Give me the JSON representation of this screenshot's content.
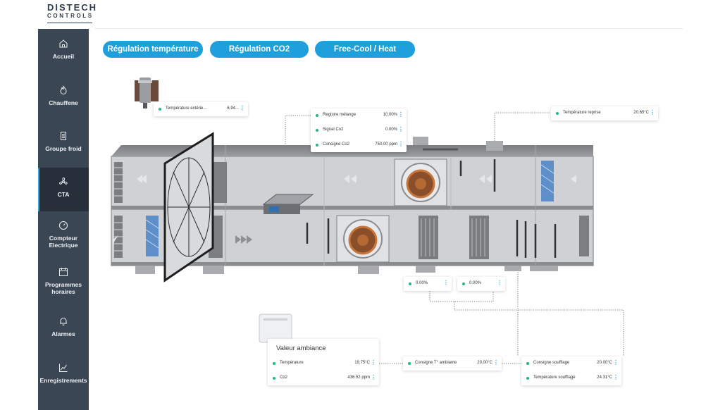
{
  "brand": {
    "line1": "DISTECH",
    "line2": "CONTROLS"
  },
  "sidebar": {
    "items": [
      {
        "label": "Accueil",
        "icon": "home-icon"
      },
      {
        "label": "Chauffene",
        "icon": "flame-icon"
      },
      {
        "label": "Groupe froid",
        "icon": "chiller-icon"
      },
      {
        "label": "CTA",
        "icon": "fan-icon"
      },
      {
        "label": "Compteur Electrique",
        "icon": "meter-icon"
      },
      {
        "label": "Programmes horaires",
        "icon": "calendar-icon"
      },
      {
        "label": "Alarmes",
        "icon": "bell-icon"
      },
      {
        "label": "Enregistrements",
        "icon": "chart-line-icon"
      }
    ],
    "active": "CTA",
    "colors": {
      "background": "#3b4654",
      "active_background": "#262f3a",
      "accent": "#2aa7de"
    }
  },
  "tabs": [
    {
      "label": "Régulation température"
    },
    {
      "label": "Régulation CO2"
    },
    {
      "label": "Free-Cool / Heat"
    }
  ],
  "tab_color": "#1f9fdb",
  "status_color": "#24b784",
  "menu_glyph": "⋮",
  "cards": {
    "ext_temp": {
      "label": "Température extérie...",
      "value": "6.94..."
    },
    "mix": [
      {
        "label": "Registre mélange",
        "value": "10.00%"
      },
      {
        "label": "Signal Co2",
        "value": "0.00%"
      },
      {
        "label": "Consigne Co2",
        "value": "750.00 ppm"
      }
    ],
    "return_temp": {
      "label": "Température reprise",
      "value": "20.65°C"
    },
    "valve1": {
      "value": "0.00%"
    },
    "valve2": {
      "value": "0.00%"
    },
    "ambiance": {
      "title": "Valeur ambiance",
      "rows": [
        {
          "label": "Température",
          "value": "19.75°C"
        },
        {
          "label": "Co2",
          "value": "436.52 ppm"
        }
      ]
    },
    "consigne_amb": {
      "label": "Consigne T° ambiante",
      "value": "20.00°C"
    },
    "supply": [
      {
        "label": "Consigne soufflage",
        "value": "20.00°C"
      },
      {
        "label": "Température soufflage",
        "value": "24.31°C"
      }
    ]
  }
}
